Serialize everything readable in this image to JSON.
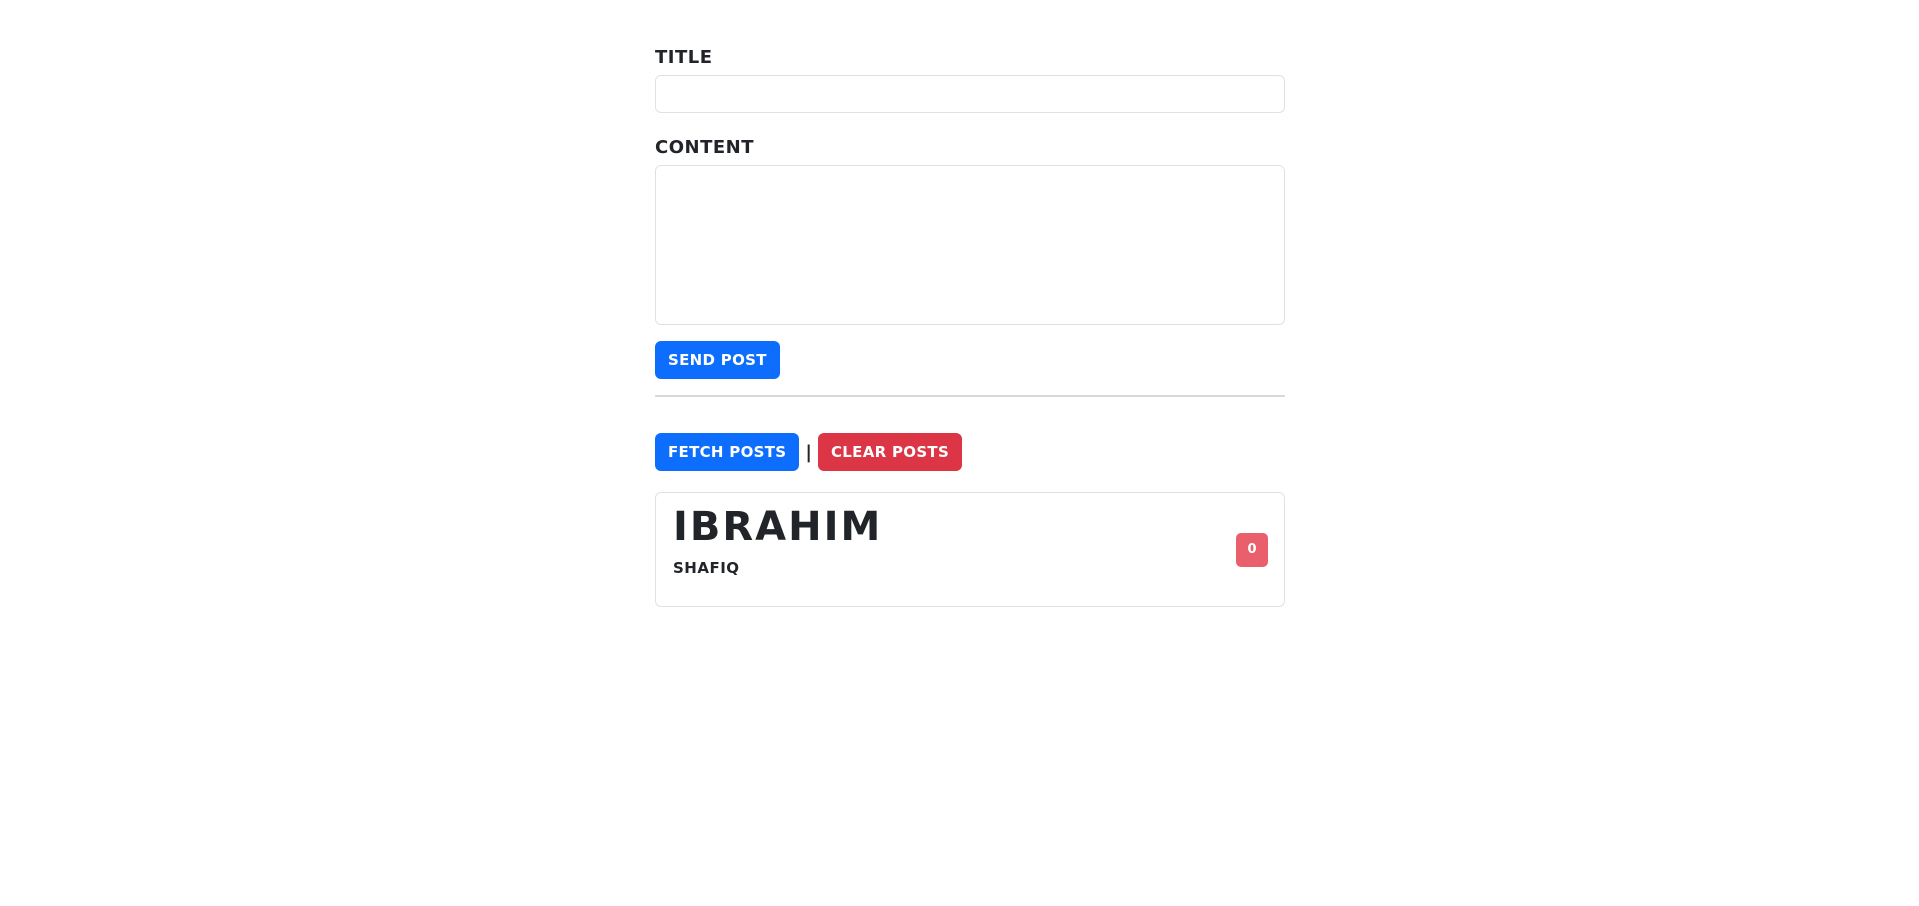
{
  "form": {
    "title_label": "Title",
    "title_value": "",
    "content_label": "Content",
    "content_value": "",
    "send_button": "Send Post"
  },
  "actions": {
    "fetch_button": "Fetch Posts",
    "separator": "|",
    "clear_button": "Clear Posts"
  },
  "posts": [
    {
      "title": "Ibrahim",
      "content": "Shafiq",
      "delete_label": "0"
    }
  ],
  "colors": {
    "primary": "#0d6efd",
    "danger": "#dc3545",
    "badge": "#ea5f6c",
    "text": "#212529",
    "border": "#dee2e6"
  }
}
